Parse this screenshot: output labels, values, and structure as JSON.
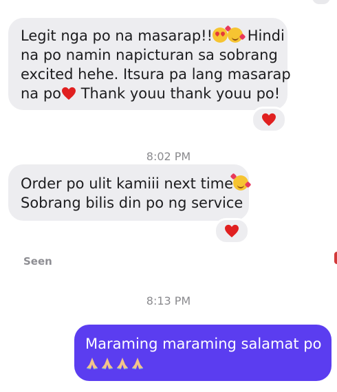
{
  "messages": [
    {
      "direction": "incoming",
      "lines": [
        "Legit nga po na masarap!!",
        "na po namin napicturan sa sobrang",
        "excited hehe. Itsura pa lang masarap",
        "na po",
        " Thank youu thank youu po!"
      ],
      "line1_after_emoji": " Hindi",
      "reaction": "red-heart"
    },
    {
      "direction": "incoming",
      "lines": [
        "Order po ulit kamiii next time",
        "Sobrang bilis din po ng service"
      ],
      "reaction": "red-heart"
    },
    {
      "direction": "outgoing",
      "lines": [
        "Maraming maraming salamat po"
      ],
      "trailing_emoji": "folded-hands x4"
    }
  ],
  "timestamps": [
    "8:02 PM",
    "8:13 PM"
  ],
  "seen_label": "Seen",
  "colors": {
    "incoming_bubble": "#ededf0",
    "outgoing_bubble": "#5b3df0",
    "heart": "#e02020",
    "timestamp": "#8a8a8e"
  }
}
